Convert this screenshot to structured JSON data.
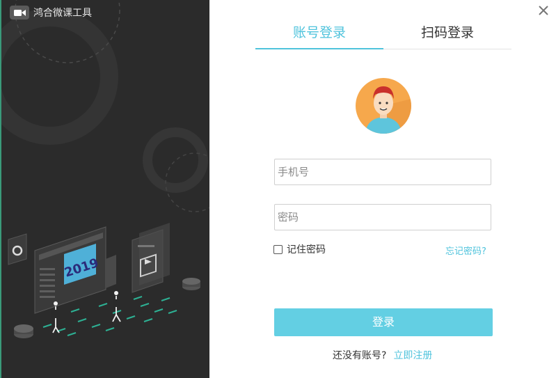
{
  "app": {
    "title": "鸿合微课工具"
  },
  "tabs": [
    {
      "label": "账号登录",
      "active": true
    },
    {
      "label": "扫码登录",
      "active": false
    }
  ],
  "form": {
    "phone_placeholder": "手机号",
    "password_placeholder": "密码",
    "remember_label": "记住密码",
    "remember_checked": false,
    "forgot_label": "忘记密码?",
    "login_label": "登录"
  },
  "register": {
    "prompt": "还没有账号?",
    "link_label": "立即注册"
  },
  "illustration": {
    "year": "2019"
  },
  "colors": {
    "accent": "#4fc3dc",
    "button": "#63cfe3",
    "left_bg": "#2b2b2b",
    "avatar_bg": "#f6a84c",
    "avatar_shirt": "#5ec5dc"
  },
  "icons": [
    "video-camera-icon",
    "close-icon",
    "user-avatar-icon",
    "gear-icon",
    "film-icon"
  ]
}
